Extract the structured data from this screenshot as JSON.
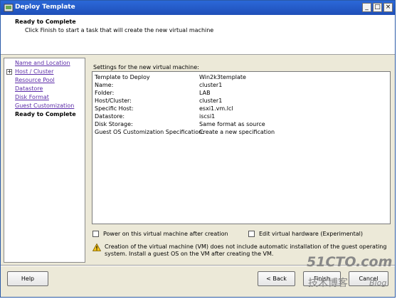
{
  "window": {
    "title": "Deploy Template",
    "icon": "vm-template-icon",
    "controls": {
      "minimize": "_",
      "maximize": "□",
      "close": "×"
    }
  },
  "header": {
    "title": "Ready to Complete",
    "subtitle": "Click Finish to start a task that will create the new virtual machine"
  },
  "nav": {
    "items": [
      {
        "label": "Name and Location"
      },
      {
        "label": "Host / Cluster",
        "expand": "+"
      },
      {
        "label": "Resource Pool"
      },
      {
        "label": "Datastore"
      },
      {
        "label": "Disk Format"
      },
      {
        "label": "Guest Customization"
      },
      {
        "label": "Ready to Complete"
      }
    ]
  },
  "settings": {
    "label": "Settings for the new virtual machine:",
    "rows": [
      {
        "key": "Template to Deploy",
        "value": "Win2k3template"
      },
      {
        "key": "Name:",
        "value": "cluster1"
      },
      {
        "key": "Folder:",
        "value": "LAB"
      },
      {
        "key": "Host/Cluster:",
        "value": "cluster1"
      },
      {
        "key": "Specific Host:",
        "value": "esxi1.vm.lcl"
      },
      {
        "key": "Datastore:",
        "value": "iscsi1"
      },
      {
        "key": "Disk Storage:",
        "value": "Same format as source"
      },
      {
        "key": "Guest OS Customization Specification:",
        "value": "Create a new specification"
      }
    ]
  },
  "options": {
    "power_on": {
      "label": "Power on this virtual machine after creation",
      "checked": false
    },
    "edit_hardware": {
      "label": "Edit virtual hardware (Experimental)",
      "checked": false
    }
  },
  "note": "Creation of the virtual machine (VM) does not include automatic installation of the guest operating system. Install a guest OS on the VM after creating the VM.",
  "buttons": {
    "help": "Help",
    "back": "< Back",
    "finish": "Finish",
    "cancel": "Cancel"
  },
  "watermark": {
    "main": "51CTO.com",
    "sub": "技术博客",
    "blog": "Blog"
  }
}
